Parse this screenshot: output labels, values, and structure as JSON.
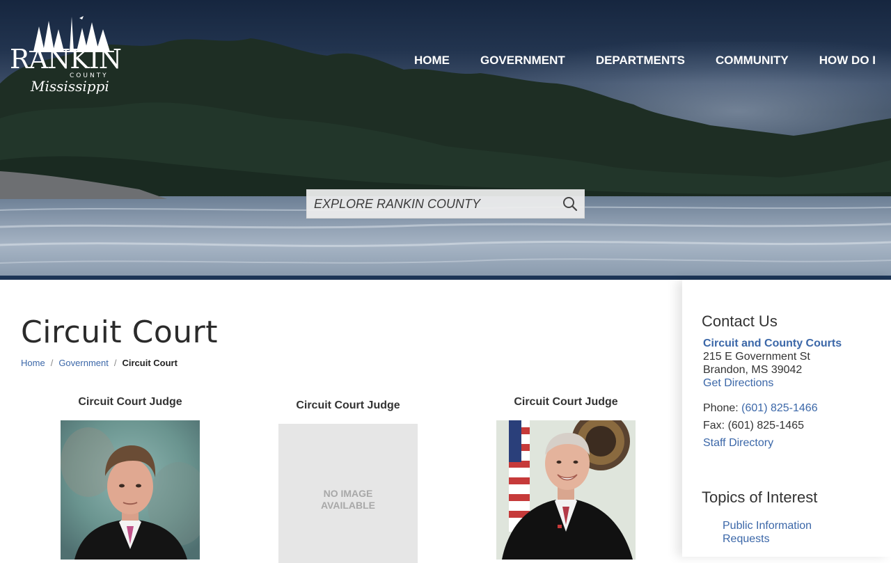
{
  "site": {
    "logo": {
      "name": "RANKIN",
      "county": "COUNTY",
      "state": "Mississippi"
    }
  },
  "nav": {
    "items": [
      "HOME",
      "GOVERNMENT",
      "DEPARTMENTS",
      "COMMUNITY",
      "HOW DO I"
    ]
  },
  "search": {
    "placeholder": "EXPLORE RANKIN COUNTY",
    "icon": "search-icon"
  },
  "page": {
    "title": "Circuit Court",
    "breadcrumb": [
      {
        "label": "Home",
        "link": true
      },
      {
        "label": "Government",
        "link": true
      },
      {
        "label": "Circuit Court",
        "link": false
      }
    ]
  },
  "judges": [
    {
      "title": "Circuit Court Judge",
      "photo": "judge-photo"
    },
    {
      "title": "Circuit Court Judge",
      "photo": "no-image",
      "placeholder_line1": "NO IMAGE",
      "placeholder_line2": "AVAILABLE"
    },
    {
      "title": "Circuit Court Judge",
      "photo": "judge-photo"
    }
  ],
  "sidebar": {
    "contact": {
      "heading": "Contact Us",
      "department": "Circuit and County Courts",
      "address_line1": "215 E Government St",
      "address_line2": "Brandon, MS 39042",
      "directions_label": "Get Directions",
      "phone_label": "Phone:",
      "phone": "(601) 825-1466",
      "fax_label": "Fax:",
      "fax": "(601) 825-1465",
      "staff_directory_label": "Staff Directory"
    },
    "topics": {
      "heading": "Topics of Interest",
      "items": [
        "Public Information Requests"
      ]
    }
  },
  "colors": {
    "link": "#3b67a8",
    "heading": "#2b2b2b",
    "hero_bar": "#1c3556"
  }
}
